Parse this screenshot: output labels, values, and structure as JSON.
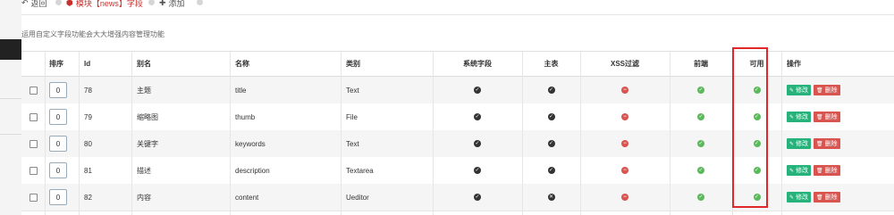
{
  "toolbar": {
    "back_label": "返回",
    "module_label": "模块【news】字段",
    "add_label": "添加"
  },
  "description": "运用自定义字段功能会大大增强内容管理功能",
  "table": {
    "headers": {
      "sort": "排序",
      "id": "Id",
      "alias": "别名",
      "name": "名称",
      "type": "类别",
      "system": "系统字段",
      "main": "主表",
      "xss": "XSS过滤",
      "front": "前端",
      "enabled": "可用",
      "actions": "操作"
    },
    "rows": [
      {
        "sort": "0",
        "id": "78",
        "alias": "主题",
        "name": "title",
        "type": "Text",
        "system": "dark",
        "main": "dark",
        "xss": "red",
        "front": "green",
        "enabled": "green"
      },
      {
        "sort": "0",
        "id": "79",
        "alias": "缩略图",
        "name": "thumb",
        "type": "File",
        "system": "dark",
        "main": "dark",
        "xss": "red",
        "front": "green",
        "enabled": "green"
      },
      {
        "sort": "0",
        "id": "80",
        "alias": "关键字",
        "name": "keywords",
        "type": "Text",
        "system": "dark",
        "main": "dark",
        "xss": "red",
        "front": "green",
        "enabled": "green"
      },
      {
        "sort": "0",
        "id": "81",
        "alias": "描述",
        "name": "description",
        "type": "Textarea",
        "system": "dark",
        "main": "dark",
        "xss": "red",
        "front": "green",
        "enabled": "green"
      },
      {
        "sort": "0",
        "id": "82",
        "alias": "内容",
        "name": "content",
        "type": "Ueditor",
        "system": "dark",
        "main": "dark-x",
        "xss": "red",
        "front": "green",
        "enabled": "green"
      }
    ],
    "edit_label": "修改",
    "delete_label": "删除"
  },
  "colors": {
    "accent_green": "#26b27a",
    "danger_red": "#d9534f",
    "highlight_box": "#e0282a"
  }
}
